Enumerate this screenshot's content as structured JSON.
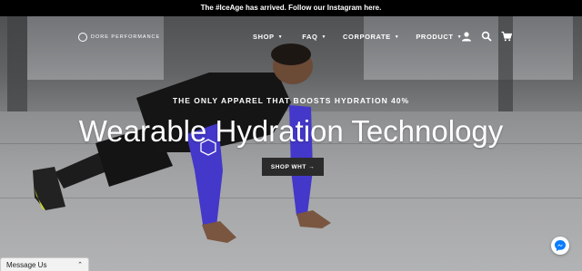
{
  "announcement": {
    "text": "The #IceAge has arrived. Follow our Instagram here."
  },
  "brand": {
    "name": "DORE PERFORMANCE"
  },
  "nav": {
    "items": [
      {
        "label": "SHOP"
      },
      {
        "label": "FAQ"
      },
      {
        "label": "CORPORATE"
      },
      {
        "label": "PRODUCT"
      }
    ],
    "icons": [
      "user-icon",
      "search-icon",
      "cart-icon"
    ]
  },
  "hero": {
    "tagline": "THE ONLY APPAREL THAT BOOSTS HYDRATION 40%",
    "headline": "Wearable Hydration Technology",
    "cta_label": "SHOP WHT →"
  },
  "chat": {
    "label": "Message Us"
  },
  "colors": {
    "sleeve": "#4338c9",
    "button": "#2b2b2b",
    "announce_bg": "#000000"
  }
}
